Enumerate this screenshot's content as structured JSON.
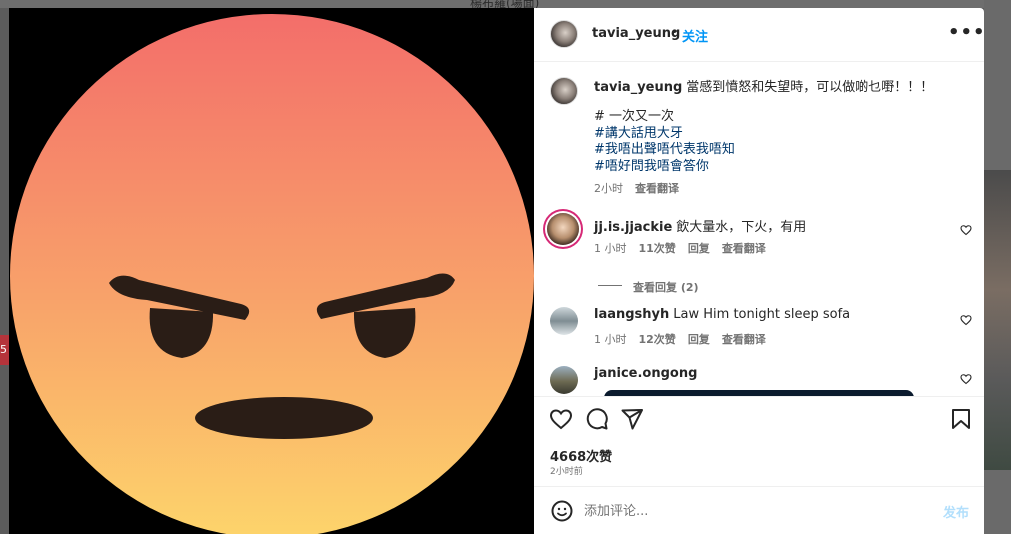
{
  "background": {
    "top_text": "楊布羅(場面)",
    "left_badge": "5"
  },
  "media": {
    "emoji_icon": "angry-face-emoji",
    "colors": {
      "face_top": "#F36E6A",
      "face_bottom": "#FDD46B",
      "features": "#2A1D16",
      "backdrop": "#000000"
    }
  },
  "header": {
    "username": "tavia_yeung",
    "separator": "•",
    "follow_label": "关注",
    "more_icon": "more-horizontal-icon",
    "more_label": "•••"
  },
  "caption": {
    "username": "tavia_yeung",
    "text": "當感到憤怒和失望時，可以做啲乜嘢！！！",
    "lines": [
      "# 一次又一次",
      "#講大話甩大牙",
      "#我唔出聲唔代表我唔知",
      "#唔好問我唔會答你"
    ],
    "time": "2小时",
    "translate": "查看翻译"
  },
  "comments": [
    {
      "username": "jj.is.jjackie",
      "text": "飲大量水，下火，有用",
      "time": "1 小时",
      "likes": "11次赞",
      "reply": "回复",
      "translate": "查看翻译",
      "view_replies": "查看回复 (2)"
    },
    {
      "username": "laangshyh",
      "text": "Law Him tonight sleep sofa",
      "time": "1 小时",
      "likes": "12次赞",
      "reply": "回复",
      "translate": "查看翻译"
    },
    {
      "username": "janice.ongong",
      "text": ""
    }
  ],
  "actions": {
    "like_icon": "heart-icon",
    "comment_icon": "comment-icon",
    "share_icon": "send-icon",
    "save_icon": "bookmark-icon"
  },
  "likes_count": "4668次赞",
  "posted_time": "2小时前",
  "add_comment": {
    "emoji_icon": "smile-icon",
    "placeholder": "添加评论...",
    "post_label": "发布"
  },
  "colors": {
    "accent": "#0095F6",
    "hashtag": "#00376B",
    "muted": "#737373",
    "post_disabled": "#B2DFFC"
  }
}
